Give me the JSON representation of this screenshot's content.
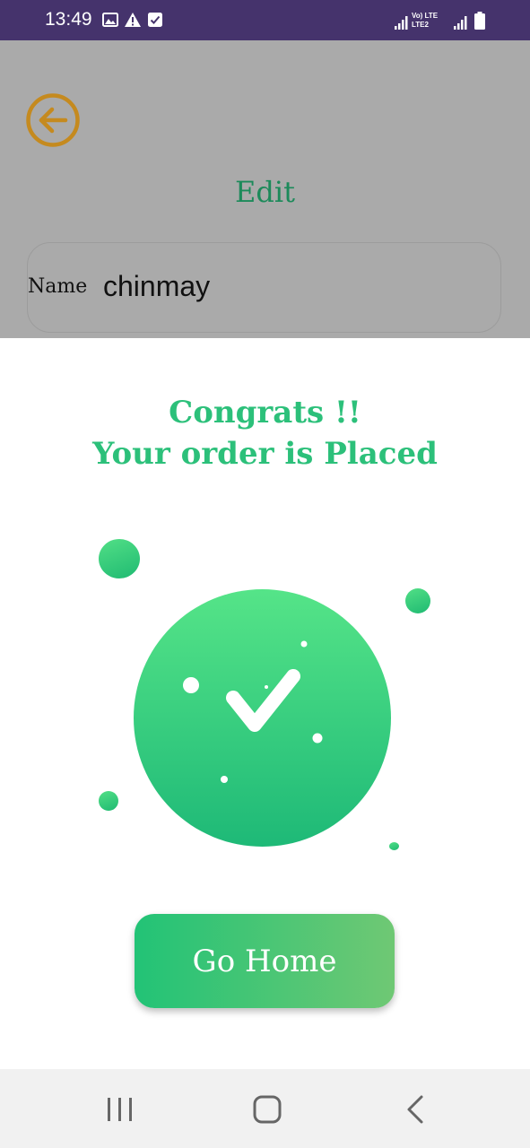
{
  "status_bar": {
    "time": "13:49",
    "network_label_top": "Vo) LTE",
    "network_label_bottom": "LTE2",
    "background_color": "#45336c",
    "left_icons": [
      "image-icon",
      "warning-icon",
      "checkbox-icon"
    ],
    "right_icons": [
      "signal-icon",
      "signal-icon",
      "battery-icon"
    ]
  },
  "background_page": {
    "title": "Edit",
    "name_field": {
      "label": "Name",
      "value": "chinmay"
    },
    "back_icon": "arrow-left-circle-icon",
    "accent_color": "#c58a1f"
  },
  "sheet": {
    "congrats_line1": "Congrats !!",
    "congrats_line2": "Your order is Placed",
    "success_icon": "check-icon",
    "accent_color": "#2cc07a",
    "go_home_label": "Go Home"
  },
  "nav_bar": {
    "buttons": [
      "recent-apps-icon",
      "home-icon",
      "back-icon"
    ]
  }
}
